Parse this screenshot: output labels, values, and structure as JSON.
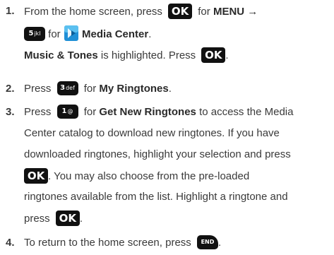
{
  "steps": [
    {
      "num": "1.",
      "line1_pre": "From the home screen, press",
      "key_ok": "OK",
      "line1_for": "for",
      "menu": "MENU",
      "arrow": "→",
      "key5": "5",
      "key5_sub": "jkl",
      "line2_for": "for",
      "media_center": "Media Center",
      "line2_post": ".",
      "line3_bold": "Music & Tones",
      "line3_mid": "is highlighted. Press",
      "line3_post": "."
    },
    {
      "num": "2.",
      "pre": "Press",
      "key3": "3",
      "key3_sub": "def",
      "mid": "for",
      "bold": "My Ringtones",
      "post": "."
    },
    {
      "num": "3.",
      "l1_pre": "Press",
      "key1": "1",
      "key1_sub": "@",
      "l1_mid": "for",
      "l1_bold": "Get New Ringtones",
      "l1_post": "to access the Media",
      "l2": "Center catalog to download new ringtones. If you have",
      "l3": "downloaded ringtones, highlight your selection and press",
      "l4_post": ". You may also choose from the pre-loaded",
      "l5": "ringtones available from the list. Highlight a ringtone and",
      "l6_pre": "press",
      "l6_post": "."
    },
    {
      "num": "4.",
      "pre": "To return to the home screen, press",
      "key_end": "END",
      "post": "."
    }
  ]
}
